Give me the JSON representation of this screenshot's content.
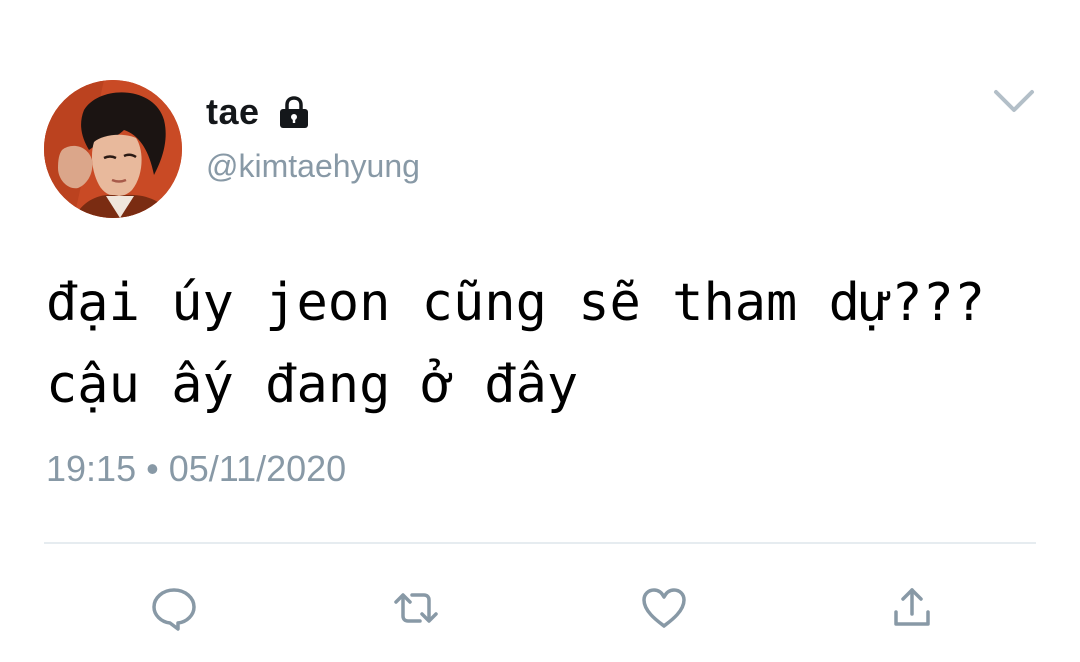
{
  "user": {
    "display_name": "tae",
    "handle": "@kimtaehyung",
    "protected_icon": "lock-icon",
    "avatar": "profile-photo"
  },
  "tweet": {
    "lines": [
      "đại úy jeon cũng sẽ tham dự???",
      "cậu ấy đang ở đây"
    ],
    "time": "19:15",
    "separator": "•",
    "date": "05/11/2020"
  },
  "actions": [
    {
      "icon": "reply-icon"
    },
    {
      "icon": "retweet-icon"
    },
    {
      "icon": "like-icon"
    },
    {
      "icon": "share-icon"
    }
  ],
  "menu": {
    "icon": "chevron-down-icon"
  },
  "colors": {
    "text_primary": "#14171a",
    "text_secondary": "#8899a6",
    "divider": "#e6ecf0",
    "icon": "#8899a6"
  }
}
